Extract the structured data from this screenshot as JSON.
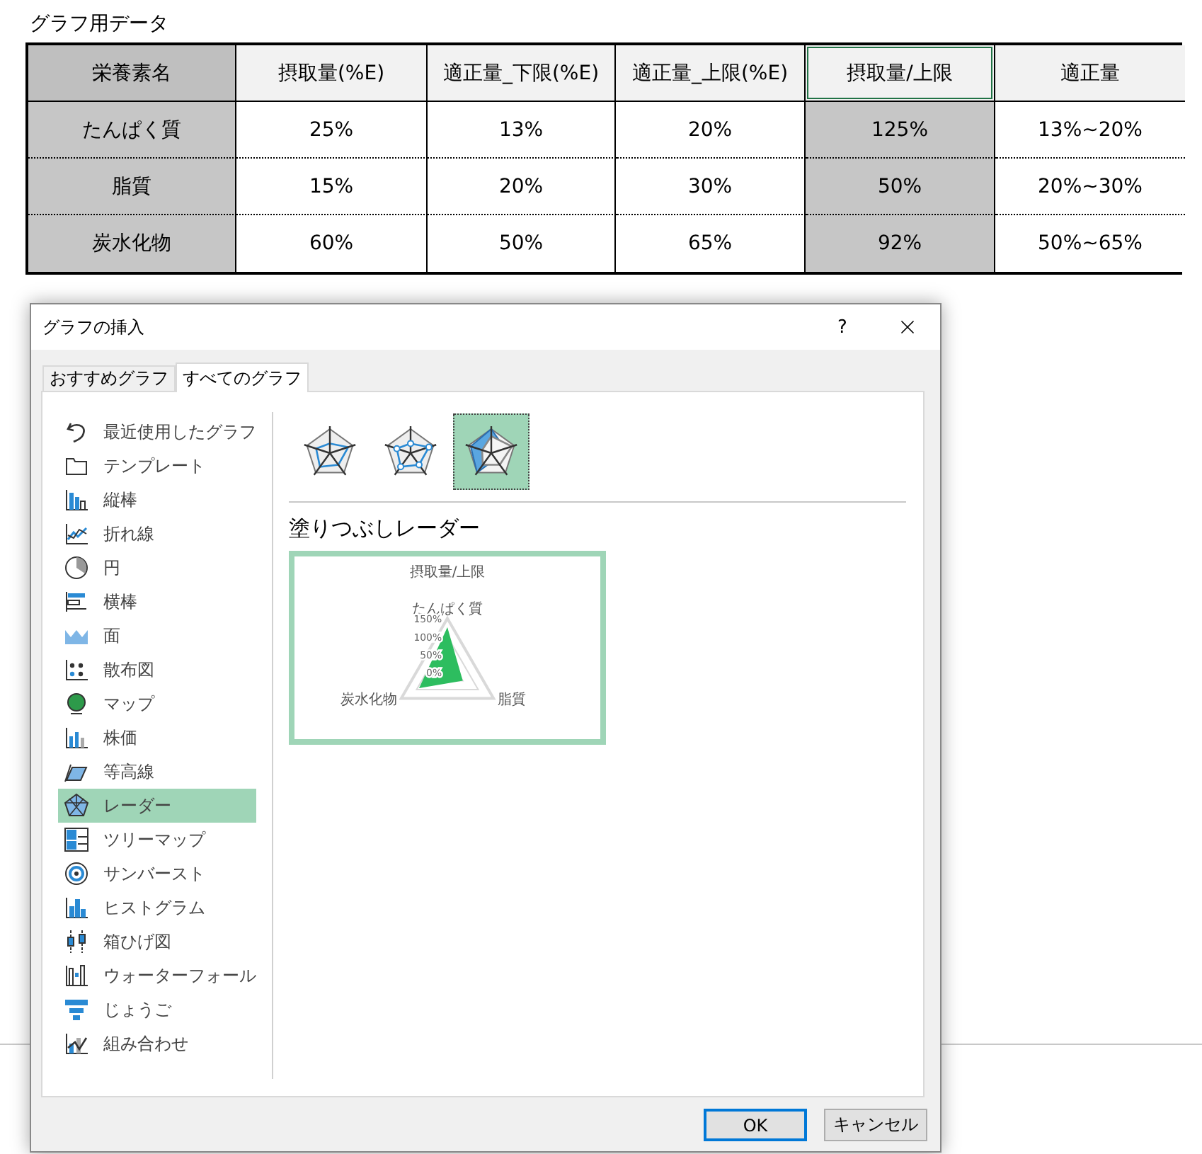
{
  "sheet": {
    "title": "グラフ用データ",
    "table": {
      "columns": [
        {
          "label": "栄養素名",
          "selected": false,
          "shaded": true
        },
        {
          "label": "摂取量(%E)",
          "selected": false,
          "shaded": false
        },
        {
          "label": "適正量_下限(%E)",
          "selected": false,
          "shaded": false
        },
        {
          "label": "適正量_上限(%E)",
          "selected": false,
          "shaded": false
        },
        {
          "label": "摂取量/上限",
          "selected": true,
          "shaded": true
        },
        {
          "label": "適正量",
          "selected": false,
          "shaded": false
        }
      ],
      "rows": [
        {
          "cells": [
            "たんぱく質",
            "25%",
            "13%",
            "20%",
            "125%",
            "13%~20%"
          ]
        },
        {
          "cells": [
            "脂質",
            "15%",
            "20%",
            "30%",
            "50%",
            "20%~30%"
          ]
        },
        {
          "cells": [
            "炭水化物",
            "60%",
            "50%",
            "65%",
            "92%",
            "50%~65%"
          ]
        }
      ]
    }
  },
  "dialog": {
    "title": "グラフの挿入",
    "help": "?",
    "tabs": [
      {
        "label": "おすすめグラフ",
        "selected": false
      },
      {
        "label": "すべてのグラフ",
        "selected": true
      }
    ],
    "chart_types": [
      {
        "label": "最近使用したグラフ",
        "selected": false
      },
      {
        "label": "テンプレート",
        "selected": false
      },
      {
        "label": "縦棒",
        "selected": false
      },
      {
        "label": "折れ線",
        "selected": false
      },
      {
        "label": "円",
        "selected": false
      },
      {
        "label": "横棒",
        "selected": false
      },
      {
        "label": "面",
        "selected": false
      },
      {
        "label": "散布図",
        "selected": false
      },
      {
        "label": "マップ",
        "selected": false
      },
      {
        "label": "株価",
        "selected": false
      },
      {
        "label": "等高線",
        "selected": false
      },
      {
        "label": "レーダー",
        "selected": true
      },
      {
        "label": "ツリーマップ",
        "selected": false
      },
      {
        "label": "サンバースト",
        "selected": false
      },
      {
        "label": "ヒストグラム",
        "selected": false
      },
      {
        "label": "箱ひげ図",
        "selected": false
      },
      {
        "label": "ウォーターフォール",
        "selected": false
      },
      {
        "label": "じょうご",
        "selected": false
      },
      {
        "label": "組み合わせ",
        "selected": false
      }
    ],
    "subtypes": [
      {
        "selected": false
      },
      {
        "selected": false
      },
      {
        "selected": true
      }
    ],
    "subtype_title": "塗りつぶしレーダー",
    "preview": {
      "chart_data": {
        "type": "radar",
        "title": "摂取量/上限",
        "categories": [
          "たんぱく質",
          "脂質",
          "炭水化物"
        ],
        "series": [
          {
            "color": "#2dbd5f",
            "values": [
              1.25,
              0.5,
              0.92
            ]
          }
        ],
        "ylim": [
          0,
          1.5
        ],
        "yticks": [
          {
            "value": 0,
            "label": "0%"
          },
          {
            "value": 0.5,
            "label": "50%"
          },
          {
            "value": 1,
            "label": "100%"
          },
          {
            "value": 1.5,
            "label": "150%"
          }
        ]
      }
    },
    "buttons": [
      {
        "label": "OK",
        "default": true
      },
      {
        "label": "キャンセル",
        "default": false
      }
    ]
  }
}
